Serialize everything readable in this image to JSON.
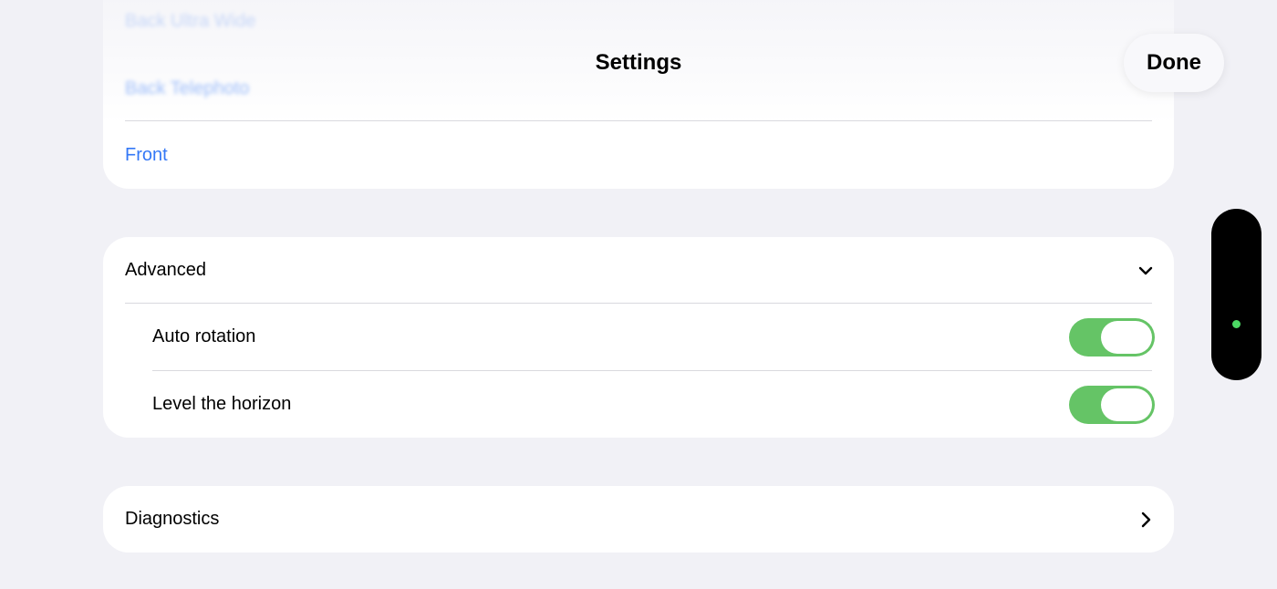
{
  "header": {
    "title": "Settings",
    "done_label": "Done"
  },
  "camera_list": {
    "items": [
      {
        "label": "Back Ultra Wide"
      },
      {
        "label": "Back Telephoto"
      },
      {
        "label": "Front"
      }
    ]
  },
  "advanced": {
    "label": "Advanced",
    "expanded": true,
    "options": [
      {
        "label": "Auto rotation",
        "on": true
      },
      {
        "label": "Level the horizon",
        "on": true
      }
    ]
  },
  "diagnostics": {
    "label": "Diagnostics"
  },
  "colors": {
    "background": "#f1f1f6",
    "accent_blue": "#3478f6",
    "toggle_on": "#65c466",
    "indicator_dot": "#4cd964"
  },
  "icons": {
    "advanced_toggle": "chevron-down-icon",
    "diagnostics_nav": "chevron-right-icon"
  }
}
